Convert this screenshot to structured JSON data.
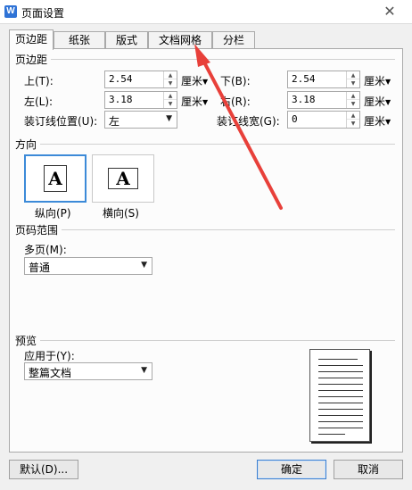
{
  "window": {
    "app_icon_letter": "W",
    "title": "页面设置",
    "close_glyph": "✕"
  },
  "tabs": [
    {
      "label": "页边距",
      "active": true
    },
    {
      "label": "纸张",
      "active": false
    },
    {
      "label": "版式",
      "active": false
    },
    {
      "label": "文档网格",
      "active": false
    },
    {
      "label": "分栏",
      "active": false
    }
  ],
  "margins": {
    "section_title": "页边距",
    "top": {
      "label": "上(T):",
      "value": "2.54",
      "unit": "厘米"
    },
    "bottom": {
      "label": "下(B):",
      "value": "2.54",
      "unit": "厘米"
    },
    "left": {
      "label": "左(L):",
      "value": "3.18",
      "unit": "厘米"
    },
    "right": {
      "label": "右(R):",
      "value": "3.18",
      "unit": "厘米"
    },
    "gutter_pos": {
      "label": "装订线位置(U):",
      "value": "左"
    },
    "gutter": {
      "label": "装订线宽(G):",
      "value": "0",
      "unit": "厘米"
    }
  },
  "orientation": {
    "section_title": "方向",
    "glyph": "A",
    "portrait_label": "纵向(P)",
    "landscape_label": "横向(S)",
    "selected": "portrait"
  },
  "page_range": {
    "section_title": "页码范围",
    "multi_label": "多页(M):",
    "multi_value": "普通"
  },
  "preview": {
    "section_title": "预览",
    "apply_label": "应用于(Y):",
    "apply_value": "整篇文档"
  },
  "buttons": {
    "default": "默认(D)...",
    "ok": "确定",
    "cancel": "取消"
  },
  "colors": {
    "selection_border": "#3c8ad8",
    "annotation_arrow": "#e8403a"
  }
}
